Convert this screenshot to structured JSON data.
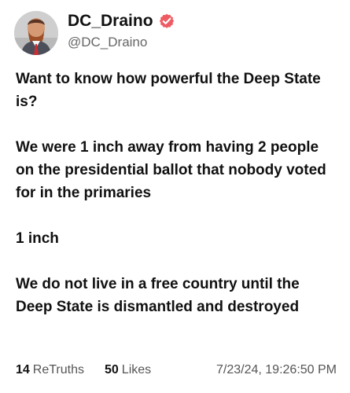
{
  "user": {
    "display_name": "DC_Draino",
    "handle": "@DC_Draino",
    "verified_icon": "verified-badge-icon",
    "avatar_icon": "profile-avatar",
    "badge_color": "#ef5b63"
  },
  "post": {
    "paragraphs": [
      "Want to know how powerful the Deep State is?",
      "We were 1 inch away from having 2 people on the presidential ballot that nobody voted for in the primaries",
      "1 inch",
      "We do not live in a free country until the Deep State is dismantled and destroyed"
    ],
    "retruths_count": "14",
    "retruths_label": "ReTruths",
    "likes_count": "50",
    "likes_label": "Likes",
    "timestamp": "7/23/24, 19:26:50 PM"
  }
}
